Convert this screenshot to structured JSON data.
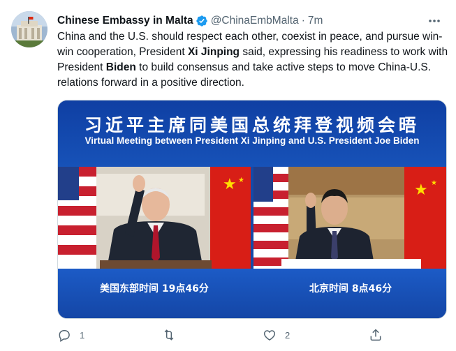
{
  "tweet": {
    "display_name": "Chinese Embassy in Malta",
    "handle": "@ChinaEmbMalta",
    "separator": "·",
    "time": "7m",
    "more_label": "•••",
    "text_parts": {
      "p1": "China and the U.S. should respect each other, coexist in peace, and pursue win-win cooperation, President ",
      "b1": "Xi Jinping",
      "p2": " said, expressing his readiness to work with President ",
      "b2": "Biden",
      "p3": " to build consensus and take active steps to move China-U.S. relations forward in a positive direction."
    }
  },
  "media": {
    "banner_cn": "习近平主席同美国总统拜登视频会晤",
    "banner_en": "Virtual Meeting between President Xi Jinping and U.S. President Joe Biden",
    "caption_left": "美国东部时间 19点46分",
    "caption_right": "北京时间 8点46分"
  },
  "actions": {
    "reply_count": "1",
    "retweet_count": "",
    "like_count": "2",
    "share_count": ""
  },
  "colors": {
    "accent": "#1d9bf0",
    "muted": "#536471",
    "banner_blue": "#1549a8"
  },
  "icons": [
    "verified-badge-icon",
    "more-icon",
    "reply-icon",
    "retweet-icon",
    "like-icon",
    "share-icon"
  ]
}
